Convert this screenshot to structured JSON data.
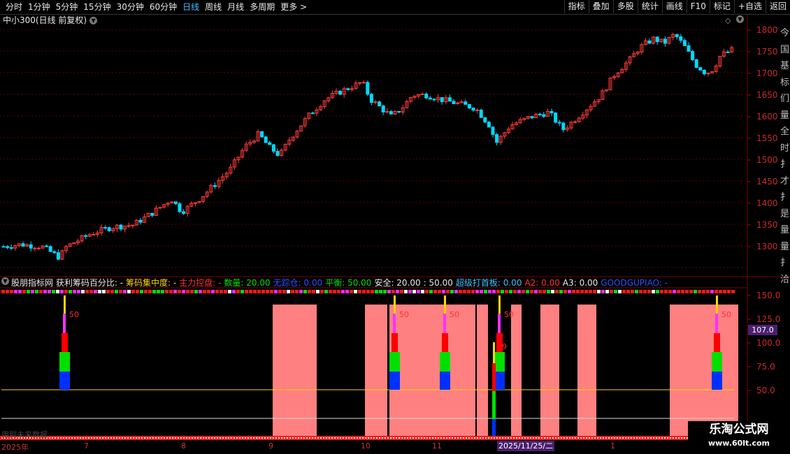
{
  "topbar": {
    "tabs": [
      "分时",
      "1分钟",
      "5分钟",
      "15分钟",
      "30分钟",
      "60分钟",
      "日线",
      "周线",
      "月线",
      "多周期",
      "更多 >"
    ],
    "active_tab": "日线",
    "right_buttons": [
      "指标",
      "叠加",
      "多股",
      "统计",
      "画线",
      "F10",
      "标记",
      "+自选",
      "返回"
    ]
  },
  "chart_header": {
    "title": "中小300(日线 前复权)"
  },
  "price_axis": {
    "ticks": [
      "1800",
      "1750",
      "1700",
      "1650",
      "1600",
      "1550",
      "1500",
      "1450",
      "1400",
      "1350",
      "1300"
    ]
  },
  "indicator": {
    "name": "股朋指标网 获利筹码百分比: -",
    "fields": [
      {
        "text": "筹码集中度: -",
        "color": "#ffd700"
      },
      {
        "text": "主力控盘: -",
        "color": "#ff3030"
      },
      {
        "text": "数量: 20.00",
        "color": "#00e000"
      },
      {
        "text": "无踪仓: 0.00",
        "color": "#3050ff"
      },
      {
        "text": "平衡: 50.00",
        "color": "#00e000"
      },
      {
        "text": "安全: 20.00",
        "color": "#e8e8e8"
      },
      {
        "text": ": 50.00",
        "color": "#e8e8e8"
      },
      {
        "text": "超级打首板: 0.00",
        "color": "#3ec0ff"
      },
      {
        "text": "A2: 0.00",
        "color": "#ff3030"
      },
      {
        "text": "A3: 0.00",
        "color": "#e8e8e8"
      },
      {
        "text": "GOODGUPIAO: -",
        "color": "#3050ff"
      }
    ],
    "axis_ticks": [
      "150.0",
      "125.0",
      "100.0",
      "75.0",
      "50.0"
    ],
    "current_value": "107.0",
    "bar_labels": [
      "50",
      "50",
      "50",
      "50",
      "9",
      "50"
    ]
  },
  "sidebar_glyphs": [
    "今",
    "国",
    "基",
    "标",
    "们",
    "量",
    "全",
    "时",
    "扌",
    "才",
    "扌",
    "是",
    "量",
    "量",
    "扌",
    "洽"
  ],
  "date_axis": {
    "labels": [
      "2025年",
      "7",
      "8",
      "9",
      "10",
      "11",
      "1"
    ],
    "highlight": "2025/11/25/二"
  },
  "no_data_text": "用到未来数据",
  "watermark": {
    "line1": "乐淘公式网",
    "line2": "www.60lt.com"
  },
  "colors": {
    "up": "#ff3c3c",
    "down": "#00d8ff",
    "grid": "#5a0000"
  }
}
